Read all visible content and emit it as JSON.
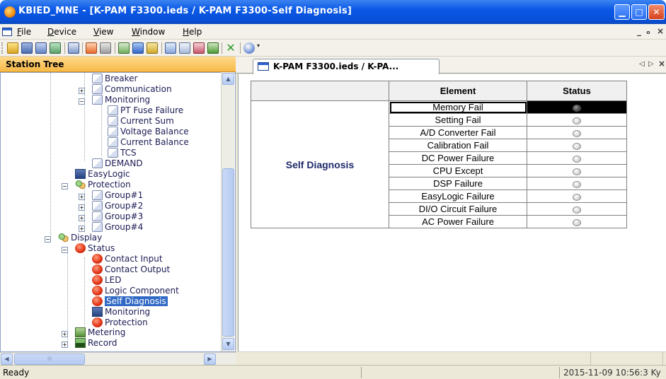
{
  "window": {
    "title": "KBIED_MNE - [K-PAM F3300.ieds / K-PAM F3300-Self Diagnosis]",
    "minimize_glyph": "▁",
    "maximize_glyph": "□",
    "close_glyph": "✕"
  },
  "menu": {
    "items": [
      "File",
      "Device",
      "View",
      "Window",
      "Help"
    ],
    "mdi_minimize": "_",
    "mdi_restore": "ₒ",
    "mdi_close": "×"
  },
  "toolbar": {
    "icons": [
      "open-icon",
      "save-icon",
      "save-all-icon",
      "network-icon",
      "tree-icon",
      "download-icon",
      "upload-icon",
      "connect-icon",
      "monitor-icon",
      "grid-icon",
      "window-icon",
      "link-icon",
      "unlink-icon",
      "export-icon",
      "delete-icon",
      "help-icon"
    ]
  },
  "station_tree": {
    "title": "Station Tree",
    "items": [
      {
        "label": "Breaker",
        "icon": "doc-icon"
      },
      {
        "label": "Communication",
        "icon": "doc-icon"
      },
      {
        "label": "Monitoring",
        "icon": "doc-icon"
      },
      {
        "label": "PT Fuse Failure",
        "icon": "doc-icon"
      },
      {
        "label": "Current Sum",
        "icon": "doc-icon"
      },
      {
        "label": "Voltage Balance",
        "icon": "doc-icon"
      },
      {
        "label": "Current Balance",
        "icon": "doc-icon"
      },
      {
        "label": "TCS",
        "icon": "doc-icon"
      },
      {
        "label": "DEMAND",
        "icon": "doc-icon"
      },
      {
        "label": "EasyLogic",
        "icon": "monitor-icon"
      },
      {
        "label": "Protection",
        "icon": "gears-icon"
      },
      {
        "label": "Group#1",
        "icon": "doc-icon"
      },
      {
        "label": "Group#2",
        "icon": "doc-icon"
      },
      {
        "label": "Group#3",
        "icon": "doc-icon"
      },
      {
        "label": "Group#4",
        "icon": "doc-icon"
      },
      {
        "label": "Display",
        "icon": "gears-icon"
      },
      {
        "label": "Status",
        "icon": "red-dot-icon"
      },
      {
        "label": "Contact Input",
        "icon": "red-dot-icon"
      },
      {
        "label": "Contact Output",
        "icon": "red-dot-icon"
      },
      {
        "label": "LED",
        "icon": "red-dot-icon"
      },
      {
        "label": "Logic Component",
        "icon": "red-dot-icon"
      },
      {
        "label": "Self Diagnosis",
        "icon": "red-dot-icon",
        "selected": true
      },
      {
        "label": "Monitoring",
        "icon": "monitor-icon"
      },
      {
        "label": "Protection",
        "icon": "red-dot-icon"
      },
      {
        "label": "Metering",
        "icon": "meter-icon"
      },
      {
        "label": "Record",
        "icon": "record-icon"
      }
    ]
  },
  "document": {
    "tab_label": "K-PAM F3300.ieds / K-PA...",
    "tab_prev": "◁",
    "tab_next": "▷",
    "tab_close": "×",
    "grid": {
      "group_label": "Self Diagnosis",
      "col_element": "Element",
      "col_status": "Status",
      "rows": [
        {
          "element": "Memory Fail",
          "status": "off"
        },
        {
          "element": "Setting Fail",
          "status": "off"
        },
        {
          "element": "A/D Converter Fail",
          "status": "off"
        },
        {
          "element": "Calibration Fail",
          "status": "off"
        },
        {
          "element": "DC Power Failure",
          "status": "off"
        },
        {
          "element": "CPU Except",
          "status": "off"
        },
        {
          "element": "DSP Failure",
          "status": "off"
        },
        {
          "element": "EasyLogic Failure",
          "status": "off"
        },
        {
          "element": "DI/O Circuit Failure",
          "status": "off"
        },
        {
          "element": "AC Power Failure",
          "status": "off"
        }
      ]
    }
  },
  "statusbar": {
    "text": "Ready",
    "datetime": "2015-11-09 10:56:3 Ky"
  },
  "colors": {
    "titlebar": "#0a58e6",
    "panel_header": "#f7b948",
    "selection": "#316ac5"
  }
}
